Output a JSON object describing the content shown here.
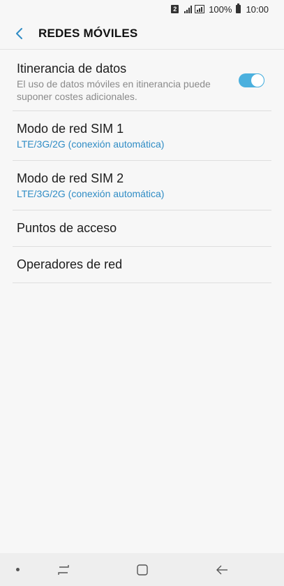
{
  "status_bar": {
    "sim_slot": "2",
    "battery": "100%",
    "time": "10:00"
  },
  "header": {
    "title": "REDES MÓVILES",
    "back_icon": "back-arrow-icon"
  },
  "settings": [
    {
      "title": "Itinerancia de datos",
      "description": "El uso de datos móviles en itinerancia puede suponer costes adicionales.",
      "toggle_on": true
    },
    {
      "title": "Modo de red SIM 1",
      "subtitle": "LTE/3G/2G (conexión automática)"
    },
    {
      "title": "Modo de red SIM 2",
      "subtitle": "LTE/3G/2G (conexión automática)"
    },
    {
      "title": "Puntos de acceso"
    },
    {
      "title": "Operadores de red"
    }
  ],
  "colors": {
    "accent": "#2f8cc5",
    "toggle": "#4bb0de",
    "background": "#f7f7f7"
  },
  "nav_bar": {
    "icons": [
      "dot-icon",
      "recents-icon",
      "home-icon",
      "back-icon"
    ]
  }
}
